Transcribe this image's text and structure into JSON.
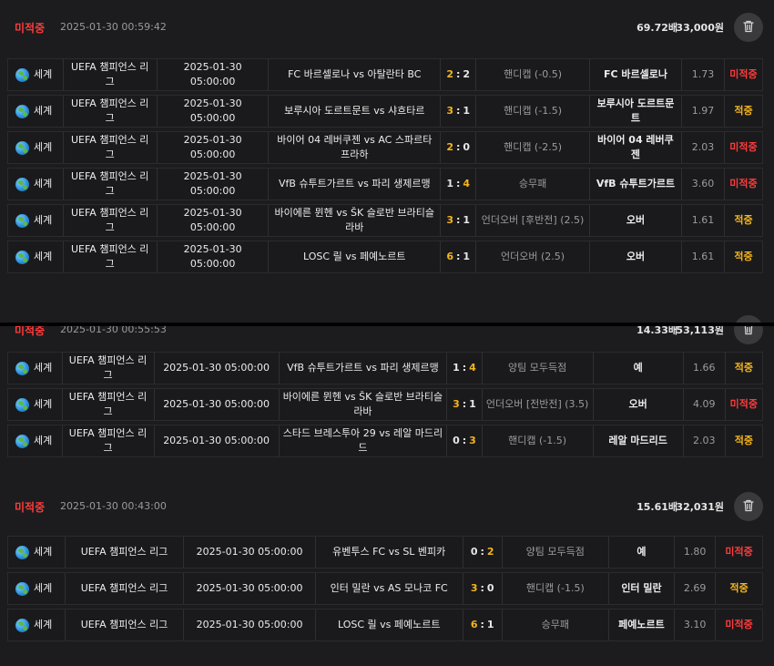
{
  "slips": [
    {
      "status": "미적중",
      "time": "2025-01-30 00:59:42",
      "total_odds": "69.72배",
      "amount": "33,000원",
      "bets": [
        {
          "region": "세계",
          "league": "UEFA 챔피언스 리그",
          "date": "2025-01-30 05:00:00",
          "match": "FC 바르셀로나 vs 아탈란타 BC",
          "score_home": "2",
          "score_sep": ":",
          "score_away": "2",
          "type": "핸디캡 (-0.5)",
          "pick": "FC 바르셀로나",
          "odds": "1.73",
          "result": "미적중"
        },
        {
          "region": "세계",
          "league": "UEFA 챔피언스 리그",
          "date": "2025-01-30 05:00:00",
          "match": "보루시아 도르트문트 vs 샤흐타르",
          "score_home": "3",
          "score_sep": ":",
          "score_away": "1",
          "type": "핸디캡 (-1.5)",
          "pick": "보루시아 도르트문트",
          "odds": "1.97",
          "result": "적중"
        },
        {
          "region": "세계",
          "league": "UEFA 챔피언스 리그",
          "date": "2025-01-30 05:00:00",
          "match": "바이어 04 레버쿠젠 vs AC 스파르타 프라하",
          "score_home": "2",
          "score_sep": ":",
          "score_away": "0",
          "type": "핸디캡 (-2.5)",
          "pick": "바이어 04 레버쿠젠",
          "odds": "2.03",
          "result": "미적중"
        },
        {
          "region": "세계",
          "league": "UEFA 챔피언스 리그",
          "date": "2025-01-30 05:00:00",
          "match": "VfB 슈투트가르트 vs 파리 생제르맹",
          "score_home": "1",
          "score_sep": ":",
          "score_away": "4",
          "type": "승무패",
          "pick": "VfB 슈투트가르트",
          "odds": "3.60",
          "result": "미적중"
        },
        {
          "region": "세계",
          "league": "UEFA 챔피언스 리그",
          "date": "2025-01-30 05:00:00",
          "match": "바이에른 뮌헨 vs ŠK 슬로반 브라티슬라바",
          "score_home": "3",
          "score_sep": ":",
          "score_away": "1",
          "type": "언더오버 [후반전] (2.5)",
          "pick": "오버",
          "odds": "1.61",
          "result": "적중"
        },
        {
          "region": "세계",
          "league": "UEFA 챔피언스 리그",
          "date": "2025-01-30 05:00:00",
          "match": "LOSC 릴 vs 페예노르트",
          "score_home": "6",
          "score_sep": ":",
          "score_away": "1",
          "type": "언더오버 (2.5)",
          "pick": "오버",
          "odds": "1.61",
          "result": "적중"
        }
      ]
    },
    {
      "status": "미적중",
      "time": "2025-01-30 00:55:53",
      "total_odds": "14.33배",
      "amount": "53,113원",
      "bets": [
        {
          "region": "세계",
          "league": "UEFA 챔피언스 리그",
          "date": "2025-01-30 05:00:00",
          "match": "VfB 슈투트가르트 vs 파리 생제르맹",
          "score_home": "1",
          "score_sep": ":",
          "score_away": "4",
          "type": "양팀 모두득점",
          "pick": "예",
          "odds": "1.66",
          "result": "적중"
        },
        {
          "region": "세계",
          "league": "UEFA 챔피언스 리그",
          "date": "2025-01-30 05:00:00",
          "match": "바이에른 뮌헨 vs ŠK 슬로반 브라티슬라바",
          "score_home": "3",
          "score_sep": ":",
          "score_away": "1",
          "type": "언더오버 [전반전] (3.5)",
          "pick": "오버",
          "odds": "4.09",
          "result": "미적중"
        },
        {
          "region": "세계",
          "league": "UEFA 챔피언스 리그",
          "date": "2025-01-30 05:00:00",
          "match": "스타드 브레스투아 29 vs 레알 마드리드",
          "score_home": "0",
          "score_sep": ":",
          "score_away": "3",
          "type": "핸디캡 (-1.5)",
          "pick": "레알 마드리드",
          "odds": "2.03",
          "result": "적중"
        }
      ]
    },
    {
      "status": "미적중",
      "time": "2025-01-30 00:43:00",
      "total_odds": "15.61배",
      "amount": "32,031원",
      "bets": [
        {
          "region": "세계",
          "league": "UEFA 챔피언스 리그",
          "date": "2025-01-30 05:00:00",
          "match": "유벤투스 FC vs SL 벤피카",
          "score_home": "0",
          "score_sep": ":",
          "score_away": "2",
          "type": "양팀 모두득점",
          "pick": "예",
          "odds": "1.80",
          "result": "미적중"
        },
        {
          "region": "세계",
          "league": "UEFA 챔피언스 리그",
          "date": "2025-01-30 05:00:00",
          "match": "인터 밀란 vs AS 모나코 FC",
          "score_home": "3",
          "score_sep": ":",
          "score_away": "0",
          "type": "핸디캡 (-1.5)",
          "pick": "인터 밀란",
          "odds": "2.69",
          "result": "적중"
        },
        {
          "region": "세계",
          "league": "UEFA 챔피언스 리그",
          "date": "2025-01-30 05:00:00",
          "match": "LOSC 릴 vs 페예노르트",
          "score_home": "6",
          "score_sep": ":",
          "score_away": "1",
          "type": "승무패",
          "pick": "페예노르트",
          "odds": "3.10",
          "result": "미적중"
        }
      ]
    }
  ],
  "icons": {
    "trash": "trash-icon",
    "region": "globe-icon"
  },
  "colors": {
    "miss": "#ff3b3b",
    "hit": "#f5b51b",
    "background": "#1c1c1e",
    "row": "#1a1a1c"
  }
}
